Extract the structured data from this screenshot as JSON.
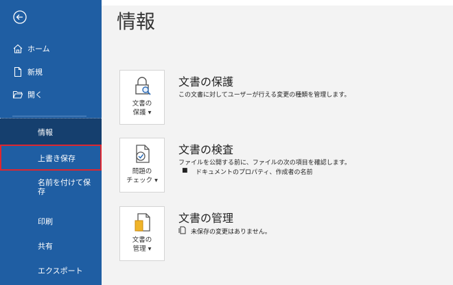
{
  "sidebar": {
    "home": "ホーム",
    "new": "新規",
    "open": "開く",
    "info": "情報",
    "save": "上書き保存",
    "save_as": "名前を付けて保存",
    "print": "印刷",
    "share": "共有",
    "export": "エクスポート"
  },
  "page_title": "情報",
  "sections": [
    {
      "card_line1": "文書の",
      "card_line2": "保護 ▾",
      "title": "文書の保護",
      "desc": "この文書に対してユーザーが行える変更の種類を管理します。"
    },
    {
      "card_line1": "問題の",
      "card_line2": "チェック ▾",
      "title": "文書の検査",
      "desc": "ファイルを公開する前に、ファイルの次の項目を確認します。",
      "bullet": "ドキュメントのプロパティ、作成者の名前"
    },
    {
      "card_line1": "文書の",
      "card_line2": "管理 ▾",
      "title": "文書の管理",
      "desc": "未保存の変更はありません。"
    }
  ],
  "colors": {
    "sidebar": "#1f5ea3",
    "sidebar_selected": "#153f6e",
    "highlight_border": "#e0262e",
    "main_bg": "#f3f3f3"
  }
}
